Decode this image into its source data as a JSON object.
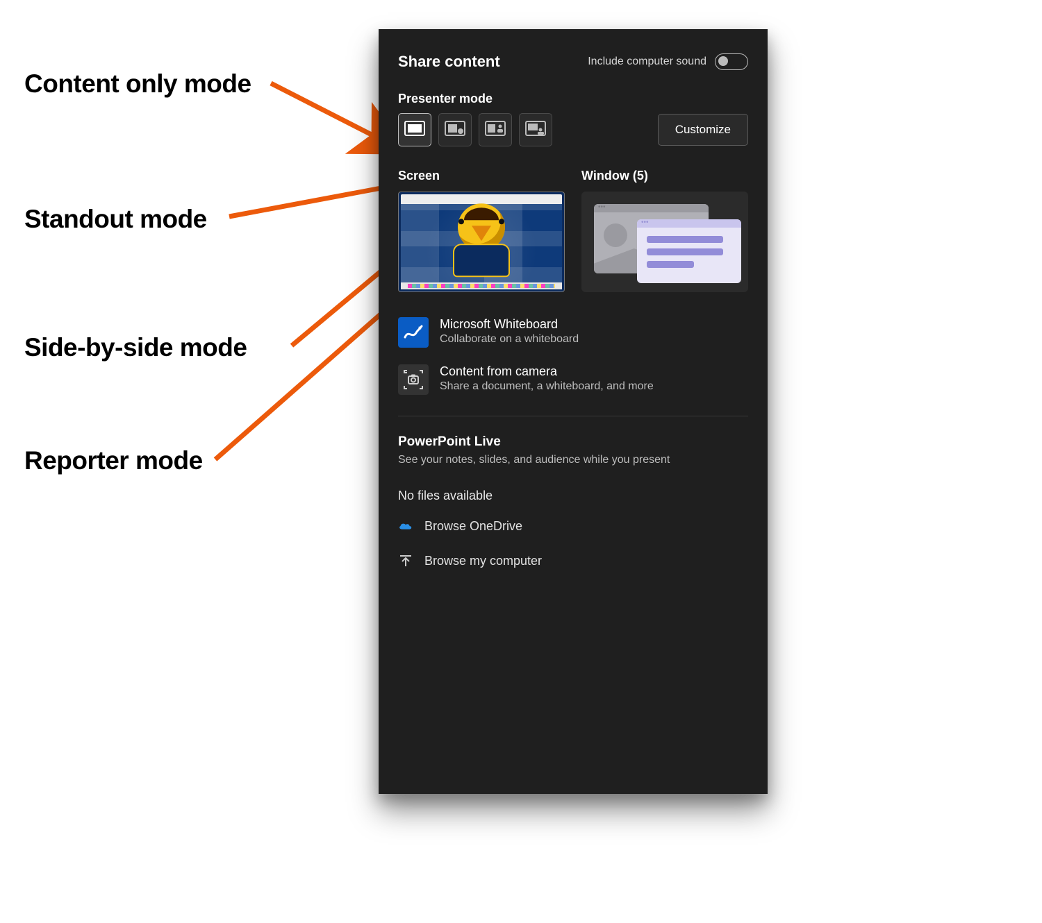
{
  "annotations": {
    "content_only": "Content only mode",
    "standout": "Standout mode",
    "side_by_side": "Side-by-side mode",
    "reporter": "Reporter mode"
  },
  "panel": {
    "title": "Share content",
    "include_sound_label": "Include computer sound",
    "presenter_mode_label": "Presenter mode",
    "customize_label": "Customize",
    "screen_label": "Screen",
    "window_label": "Window (5)",
    "options": {
      "whiteboard": {
        "title": "Microsoft Whiteboard",
        "sub": "Collaborate on a whiteboard"
      },
      "camera": {
        "title": "Content from camera",
        "sub": "Share a document, a whiteboard, and more"
      }
    },
    "powerpoint": {
      "title": "PowerPoint Live",
      "sub": "See your notes, slides, and audience while you present"
    },
    "no_files": "No files available",
    "browse": {
      "onedrive": "Browse OneDrive",
      "computer": "Browse my computer"
    }
  }
}
